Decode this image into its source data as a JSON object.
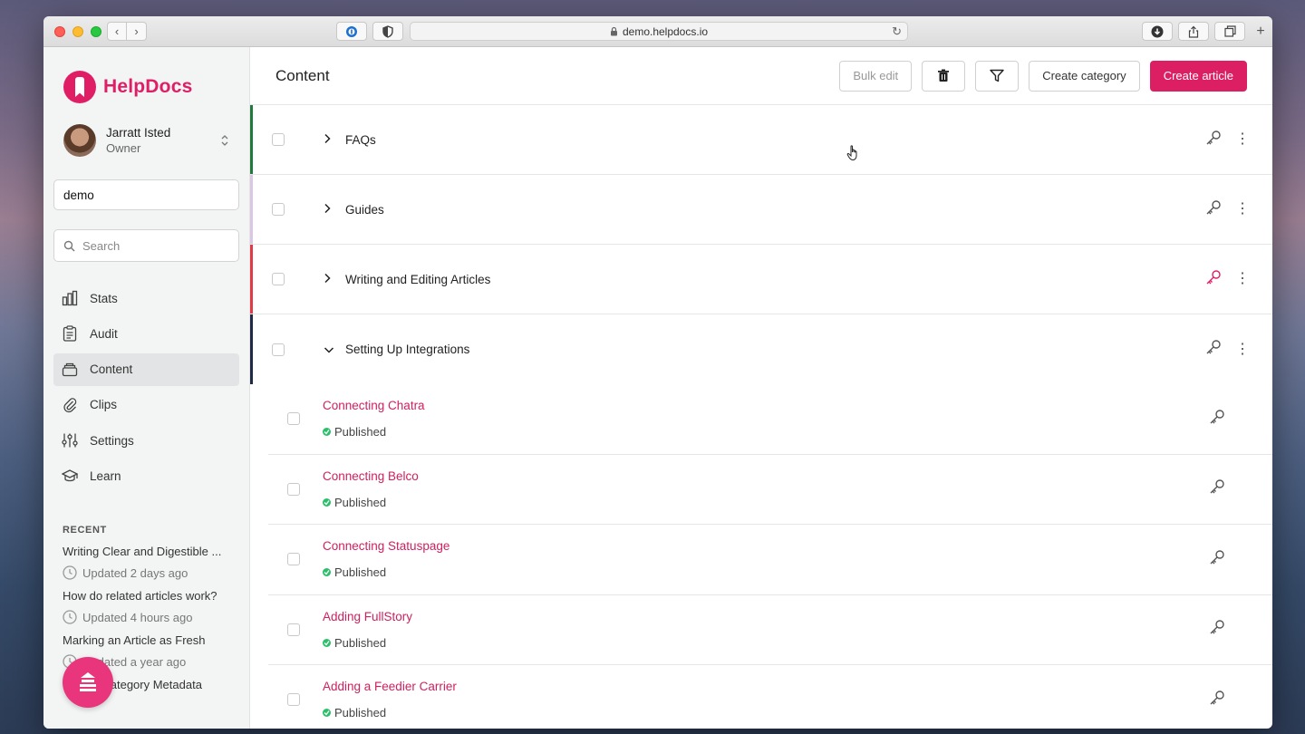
{
  "browser": {
    "url": "demo.helpdocs.io"
  },
  "brand": {
    "name": "HelpDocs"
  },
  "user": {
    "name": "Jarratt Isted",
    "role": "Owner"
  },
  "domain_input": {
    "value": "demo"
  },
  "search": {
    "placeholder": "Search"
  },
  "nav": [
    {
      "label": "Stats",
      "icon": "bar-chart-icon"
    },
    {
      "label": "Audit",
      "icon": "clipboard-icon"
    },
    {
      "label": "Content",
      "icon": "folder-stack-icon",
      "active": true
    },
    {
      "label": "Clips",
      "icon": "paperclip-icon"
    },
    {
      "label": "Settings",
      "icon": "sliders-icon"
    },
    {
      "label": "Learn",
      "icon": "graduation-cap-icon"
    }
  ],
  "recent": {
    "heading": "RECENT",
    "items": [
      {
        "title": "Writing Clear and Digestible ...",
        "meta": "Updated 2 days ago"
      },
      {
        "title": "How do related articles work?",
        "meta": "Updated 4 hours ago"
      },
      {
        "title": "Marking an Article as Fresh",
        "meta": "Updated a year ago"
      },
      {
        "title": "Editing Category Metadata",
        "meta": ""
      }
    ]
  },
  "header": {
    "title": "Content",
    "bulk_edit": "Bulk edit",
    "create_category": "Create category",
    "create_article": "Create article"
  },
  "categories": [
    {
      "name": "FAQs",
      "accent": "#1f7a3c",
      "expanded": false,
      "key_color": "#555555"
    },
    {
      "name": "Guides",
      "accent": "#d9c7e3",
      "expanded": false,
      "key_color": "#555555"
    },
    {
      "name": "Writing and Editing Articles",
      "accent": "#e03a45",
      "expanded": false,
      "key_color": "#e01e66"
    },
    {
      "name": "Setting Up Integrations",
      "accent": "#1f2a44",
      "expanded": true,
      "key_color": "#555555"
    }
  ],
  "articles": [
    {
      "title": "Connecting Chatra",
      "status": "Published"
    },
    {
      "title": "Connecting Belco",
      "status": "Published"
    },
    {
      "title": "Connecting Statuspage",
      "status": "Published"
    },
    {
      "title": "Adding FullStory",
      "status": "Published"
    },
    {
      "title": "Adding a Feedier Carrier",
      "status": "Published"
    }
  ],
  "colors": {
    "brand": "#e01e66",
    "published": "#2bbf6a"
  }
}
